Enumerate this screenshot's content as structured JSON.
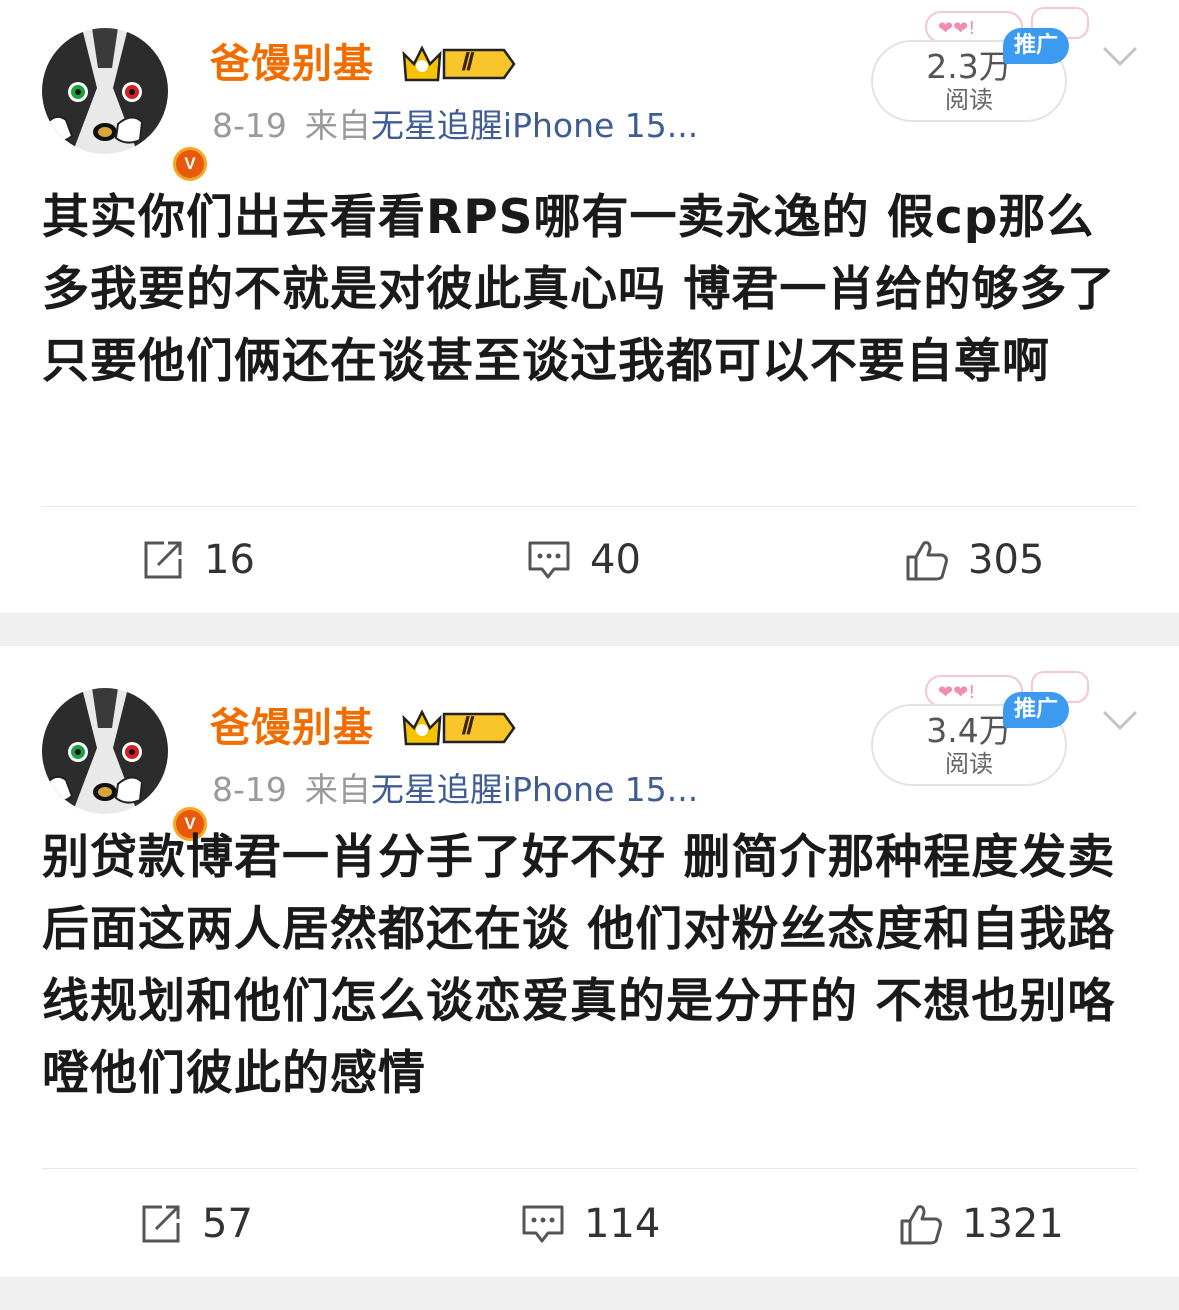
{
  "posts": [
    {
      "username": "爸馒别基",
      "vip_level": "Ⅱ",
      "date": "8-19",
      "from_label": "来自",
      "source": "无星追腥iPhone 15...",
      "reads": "2.3万",
      "reads_label": "阅读",
      "promo_label": "推广",
      "text": "其实你们出去看看RPS哪有一卖永逸的 假cp那么多我要的不就是对彼此真心吗 博君一肖给的够多了只要他们俩还在谈甚至谈过我都可以不要自尊啊",
      "reposts": "16",
      "comments": "40",
      "likes": "305"
    },
    {
      "username": "爸馒别基",
      "vip_level": "Ⅱ",
      "date": "8-19",
      "from_label": "来自",
      "source": "无星追腥iPhone 15...",
      "reads": "3.4万",
      "reads_label": "阅读",
      "promo_label": "推广",
      "text": "别贷款博君一肖分手了好不好 删简介那种程度发卖后面这两人居然都还在谈 他们对粉丝态度和自我路线规划和他们怎么谈恋爱真的是分开的 不想也别咯噔他们彼此的感情",
      "reposts": "57",
      "comments": "114",
      "likes": "1321"
    }
  ],
  "verified_mark": "V",
  "colors": {
    "username": "#f26d00",
    "source_link": "#3f5c95",
    "promo": "#3c9bf0",
    "meta": "#9a9a9a"
  },
  "icons": [
    "repost-icon",
    "comment-icon",
    "like-icon",
    "chevron-down-icon",
    "verified-badge-icon",
    "vip-crown-icon"
  ]
}
